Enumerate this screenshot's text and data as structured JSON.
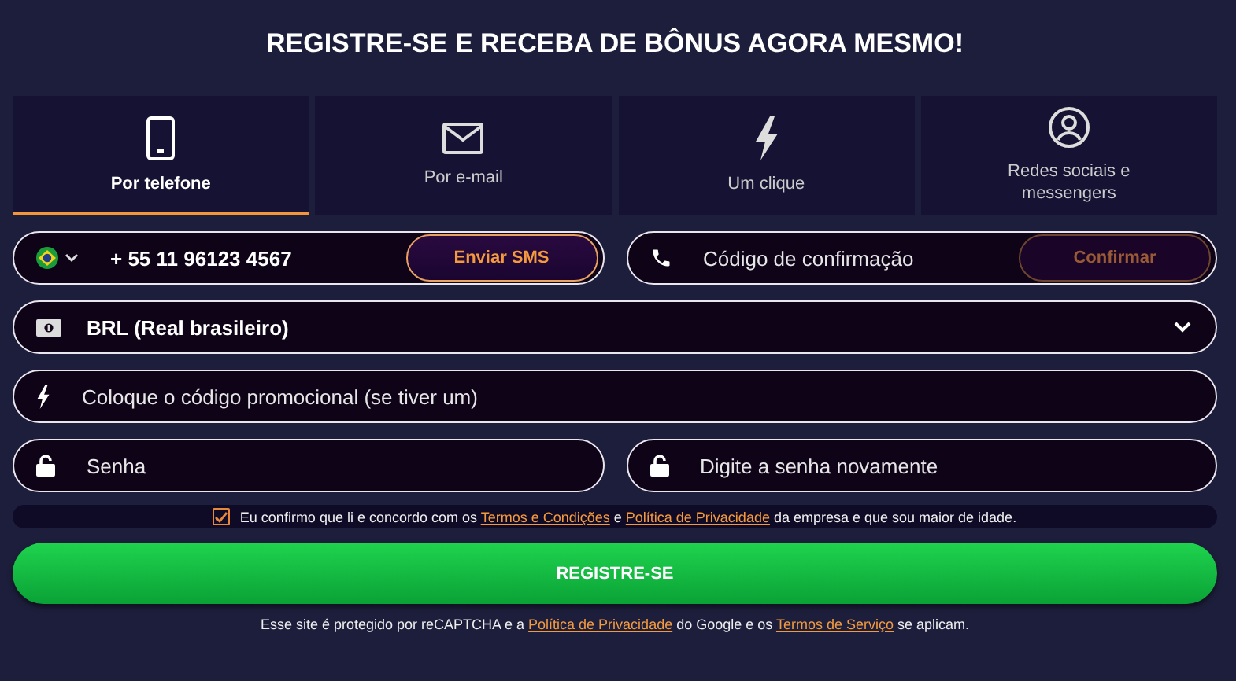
{
  "title": "REGISTRE-SE E RECEBA DE BÔNUS AGORA MESMO!",
  "tabs": [
    {
      "kind": "phone",
      "label": "Por telefone",
      "selected": true
    },
    {
      "kind": "mail",
      "label": "Por e-mail",
      "selected": false
    },
    {
      "kind": "bolt",
      "label": "Um clique",
      "selected": false
    },
    {
      "kind": "person",
      "label": "Redes sociais e messengers",
      "selected": false
    }
  ],
  "phone": {
    "value": "+ 55 11 96123 4567",
    "button": "Enviar SMS"
  },
  "code": {
    "placeholder": "Código de confirmação",
    "button": "Confirmar",
    "button_disabled": true
  },
  "currency": {
    "value": "BRL (Real brasileiro)"
  },
  "promo": {
    "placeholder": "Coloque o código promocional (se tiver um)"
  },
  "password": {
    "placeholder": "Senha"
  },
  "password_repeat": {
    "placeholder": "Digite a senha novamente"
  },
  "consent": {
    "checked": true,
    "parts": [
      {
        "kind": "text",
        "text": "Eu confirmo que li e concordo com os "
      },
      {
        "kind": "link",
        "text": "Termos e Condições"
      },
      {
        "kind": "text",
        "text": " e "
      },
      {
        "kind": "link",
        "text": "Política de Privacidade"
      },
      {
        "kind": "text",
        "text": " da empresa e que sou maior de idade."
      }
    ]
  },
  "submit": "REGISTRE-SE",
  "footer": [
    {
      "kind": "text",
      "text": "Esse site é protegido por reCAPTCHA e a "
    },
    {
      "kind": "link",
      "text": "Política de Privacidade"
    },
    {
      "kind": "text",
      "text": " do Google e os "
    },
    {
      "kind": "link",
      "text": "Termos de Serviço"
    },
    {
      "kind": "text",
      "text": " se aplicam."
    }
  ]
}
